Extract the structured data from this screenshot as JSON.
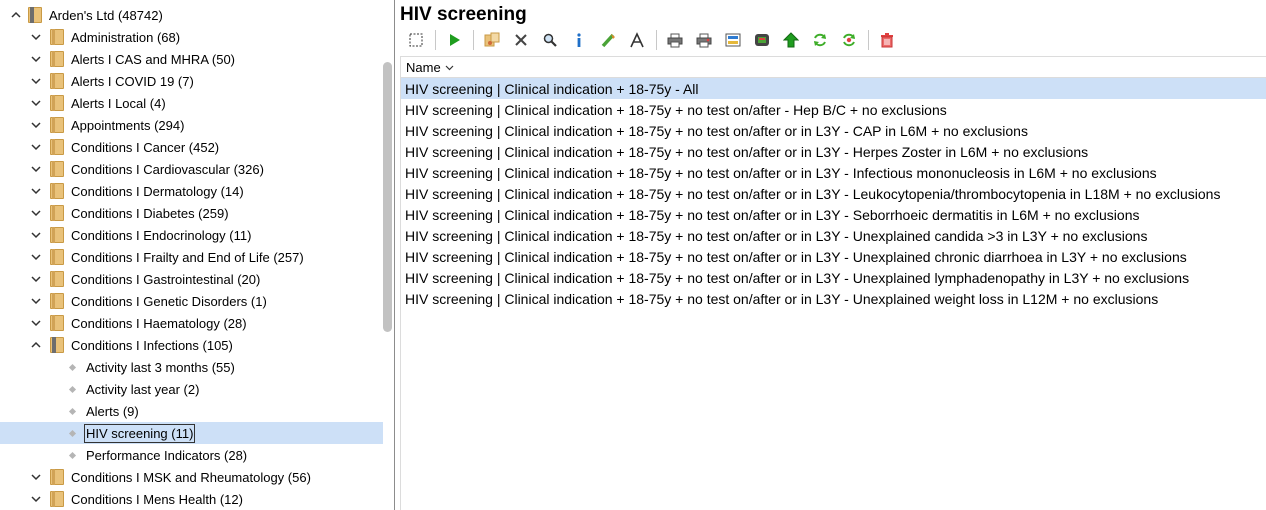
{
  "tree": {
    "root": {
      "label": "Arden's Ltd (48742)"
    },
    "folders_top": [
      {
        "label": "Administration (68)"
      },
      {
        "label": "Alerts I CAS and MHRA (50)"
      },
      {
        "label": "Alerts I COVID 19 (7)"
      },
      {
        "label": "Alerts I Local (4)"
      },
      {
        "label": "Appointments (294)"
      },
      {
        "label": "Conditions I Cancer (452)"
      },
      {
        "label": "Conditions I Cardiovascular (326)"
      },
      {
        "label": "Conditions I Dermatology (14)"
      },
      {
        "label": "Conditions I Diabetes (259)"
      },
      {
        "label": "Conditions I Endocrinology (11)"
      },
      {
        "label": "Conditions I Frailty and End of Life (257)"
      },
      {
        "label": "Conditions I Gastrointestinal (20)"
      },
      {
        "label": "Conditions I Genetic Disorders (1)"
      },
      {
        "label": "Conditions I Haematology (28)"
      }
    ],
    "expanded_folder": {
      "label": "Conditions I Infections (105)"
    },
    "leaves": [
      {
        "label": "Activity last 3 months (55)"
      },
      {
        "label": "Activity last year (2)"
      },
      {
        "label": "Alerts (9)"
      },
      {
        "label": "HIV screening (11)"
      },
      {
        "label": "Performance Indicators (28)"
      }
    ],
    "folders_bottom": [
      {
        "label": "Conditions I MSK and Rheumatology (56)"
      },
      {
        "label": "Conditions I Mens Health (12)"
      }
    ]
  },
  "main": {
    "title": "HIV screening",
    "column_header": "Name",
    "rows": [
      "HIV screening | Clinical indication + 18-75y  - All",
      "HIV screening | Clinical indication + 18-75y + no test on/after - Hep B/C + no exclusions",
      "HIV screening | Clinical indication + 18-75y + no test on/after or in L3Y - CAP in L6M + no exclusions",
      "HIV screening | Clinical indication + 18-75y + no test on/after or in L3Y - Herpes Zoster in L6M + no exclusions",
      "HIV screening | Clinical indication + 18-75y + no test on/after or in L3Y - Infectious mononucleosis in L6M + no exclusions",
      "HIV screening | Clinical indication + 18-75y + no test on/after or in L3Y - Leukocytopenia/thrombocytopenia in L18M + no exclusions",
      "HIV screening | Clinical indication + 18-75y + no test on/after or in L3Y - Seborrhoeic dermatitis in L6M + no exclusions",
      "HIV screening | Clinical indication + 18-75y + no test on/after or in L3Y - Unexplained candida >3 in L3Y + no exclusions",
      "HIV screening | Clinical indication + 18-75y + no test on/after or in L3Y - Unexplained chronic diarrhoea in L3Y + no exclusions",
      "HIV screening | Clinical indication + 18-75y + no test on/after or in L3Y - Unexplained lymphadenopathy in L3Y + no exclusions",
      "HIV screening | Clinical indication + 18-75y + no test on/after or in L3Y - Unexplained weight loss in L12M + no exclusions"
    ]
  },
  "toolbar_icons": [
    "select-all-icon",
    "run-icon",
    "edit-icon",
    "delete-icon",
    "search-icon",
    "info-icon",
    "highlight-icon",
    "font-icon",
    "print-icon",
    "print-preview-icon",
    "export-icon",
    "report-icon",
    "move-up-icon",
    "refresh-icon",
    "refresh-settings-icon",
    "trash-icon"
  ],
  "colors": {
    "selection": "#cde0f7",
    "folder": "#e9c27a",
    "accent_green": "#1f9d1f",
    "accent_blue": "#1f6fc8",
    "accent_red": "#e04040"
  }
}
